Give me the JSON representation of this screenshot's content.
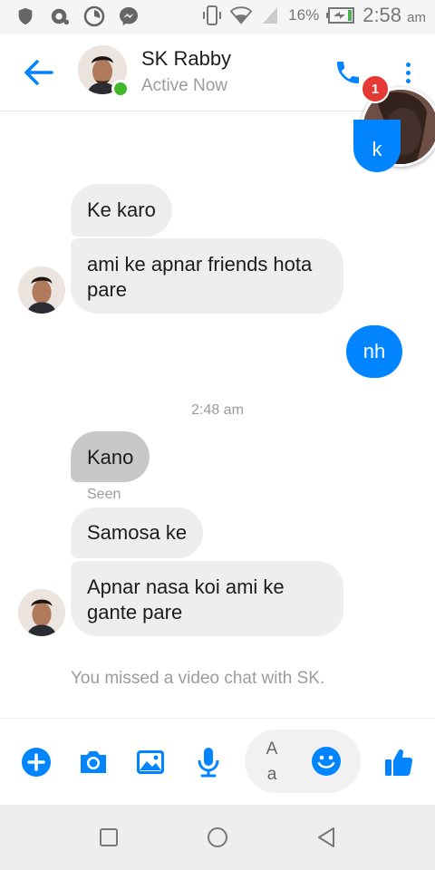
{
  "status_bar": {
    "battery_percent": "16%",
    "time": "2:58",
    "time_suffix": "am",
    "icons": [
      "shield-icon",
      "location-icon",
      "speed-icon",
      "messenger-icon",
      "vibrate-icon",
      "wifi-icon",
      "signal-icon",
      "battery-icon"
    ]
  },
  "header": {
    "contact_name": "SK Rabby",
    "status": "Active Now",
    "badge_count": "1",
    "accent_color": "#0084ff",
    "online_color": "#42b72a"
  },
  "messages": [
    {
      "direction": "out",
      "text": "k",
      "partial": true
    },
    {
      "direction": "in",
      "text": "Ke karo"
    },
    {
      "direction": "in",
      "text": "ami ke apnar friends hota pare"
    },
    {
      "direction": "out",
      "text": "nh"
    },
    {
      "type": "timestamp",
      "text": "2:48 am"
    },
    {
      "direction": "in",
      "text": "Kano",
      "selected": true
    },
    {
      "type": "receipt",
      "text": "Seen"
    },
    {
      "direction": "in",
      "text": "Samosa ke"
    },
    {
      "direction": "in",
      "text": "Apnar nasa koi ami ke gante pare"
    },
    {
      "type": "event",
      "text": "You missed a video chat with SK."
    }
  ],
  "composer": {
    "field_hint_top": "A",
    "field_hint_bottom": "a",
    "icons": [
      "plus-icon",
      "camera-icon",
      "gallery-icon",
      "mic-icon",
      "emoji-icon",
      "like-icon"
    ]
  },
  "navbar": {
    "icons": [
      "recents-icon",
      "home-icon",
      "back-icon"
    ]
  }
}
